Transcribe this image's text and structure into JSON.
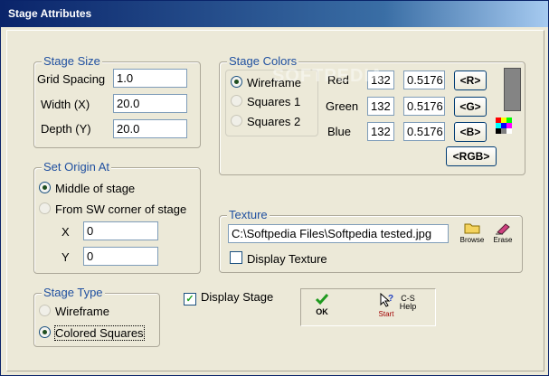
{
  "window": {
    "title": "Stage Attributes"
  },
  "stage_size": {
    "legend": "Stage Size",
    "grid_spacing_label": "Grid Spacing",
    "grid_spacing_value": "1.0",
    "width_label": "Width  (X)",
    "width_value": "20.0",
    "depth_label": "Depth  (Y)",
    "depth_value": "20.0"
  },
  "stage_colors": {
    "legend": "Stage Colors",
    "modes": [
      "Wireframe",
      "Squares 1",
      "Squares 2"
    ],
    "selected_mode": "Wireframe",
    "red_label": "Red",
    "red_int": "132",
    "red_frac": "0.5176",
    "red_button": "<R>",
    "green_label": "Green",
    "green_int": "132",
    "green_frac": "0.5176",
    "green_button": "<G>",
    "blue_label": "Blue",
    "blue_int": "132",
    "blue_frac": "0.5176",
    "blue_button": "<B>",
    "rgb_button": "<RGB>",
    "swatch_color": "#848484"
  },
  "set_origin": {
    "legend": "Set Origin At",
    "options": [
      "Middle of stage",
      "From SW corner of stage"
    ],
    "selected": "Middle of stage",
    "x_label": "X",
    "x_value": "0",
    "y_label": "Y",
    "y_value": "0"
  },
  "texture": {
    "legend": "Texture",
    "path": "C:\\Softpedia Files\\Softpedia tested.jpg",
    "browse_label": "Browse",
    "erase_label": "Erase",
    "display_texture_label": "Display Texture",
    "display_texture_checked": false
  },
  "stage_type": {
    "legend": "Stage Type",
    "options": [
      "Wireframe",
      "Colored Squares"
    ],
    "selected": "Colored Squares"
  },
  "display_stage": {
    "label": "Display Stage",
    "checked": true
  },
  "actions": {
    "ok_label": "OK",
    "start_label": "Start",
    "help_label": "C-S\nHelp"
  },
  "watermark": "SOFTPEDIA"
}
